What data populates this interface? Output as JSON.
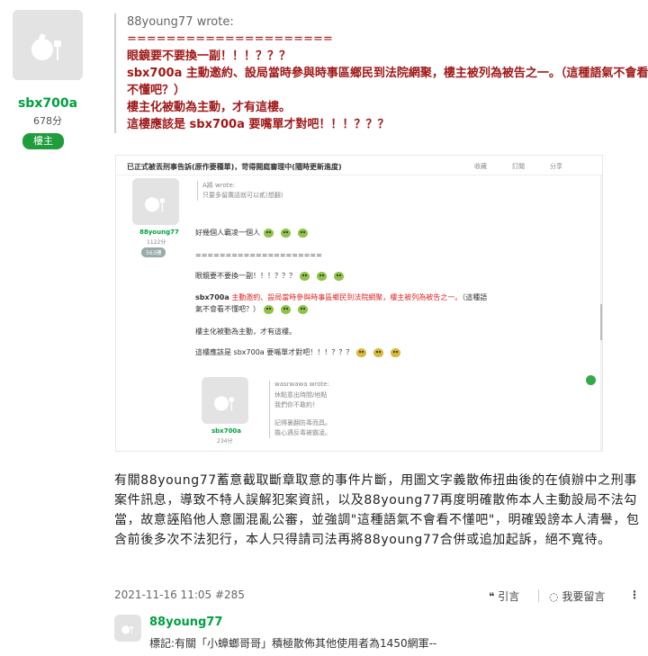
{
  "poster": {
    "username": "sbx700a",
    "points": "678分",
    "badge": "樓主"
  },
  "quote": {
    "author": "88young77 wrote:",
    "divider": "=====================",
    "lines": [
      "眼鏡要不要換一副！！！？？？",
      "sbx700a 主動邀約、設局當時參與時事區鄉民到法院網聚，樓主被列為被告之一。（這種語氣不會看",
      "不懂吧？）",
      "樓主化被動為主動，才有這樓。",
      "這樓應該是 sbx700a 要嘴單才對吧！！！？？？"
    ]
  },
  "screenshot": {
    "title": "已正式被丟刑事告訴(原作要種單)，苛得開庭審理中(隨時更新進度)",
    "actions": [
      "收藏",
      "訂閱",
      "分享"
    ],
    "user": {
      "name": "88young77",
      "points": "1122分",
      "badge": "563樓"
    },
    "quote_author": "A將 wrote:",
    "quote_text": "只要多留廣話就可以貳(想翻)",
    "line1": "好幾個人霸凌一個人",
    "divider": "=====================",
    "line2": "眼鏡要不要換一副！！！？？？",
    "line3a": "sbx700a",
    "line3b": "主動邀約、設局當時參與時事區鄉民到法院網聚，樓主被列為被告之一。",
    "line3c": "（這種語",
    "line3d": "氣不會看不懂吧？）",
    "line4": "樓主化被動為主動，才有這樓。",
    "line5": "這樓應該是 sbx700a 要嘴單才對吧！！！？？？",
    "user2": {
      "name": "sbx700a",
      "points": "234分"
    },
    "quote2_author": "wasrwawa wrote:",
    "quote2_lines": [
      "休點意出時間/地點",
      "我們你不敢約！",
      "記得裏翻防毒而具。",
      "擔心遇反毒被霸凌。"
    ]
  },
  "body": "有關88young77蓄意截取斷章取意的事件片斷，用圖文字義散佈扭曲後的在偵辦中之刑事案件訊息，導致不特人誤解犯案資訊，以及88young77再度明確散佈本人主動設局不法勾當，故意誣陷他人意圖混亂公審，並強調\"這種語氣不會看不懂吧\"，明確毀謗本人清譽，包含前後多次不法犯行，本人只得請司法再將88young77合併或追加起訴，絕不寬待。",
  "meta": {
    "date": "2021-11-16 11:05",
    "floor": "#285",
    "quote_label": "引言",
    "reply_label": "我要留言"
  },
  "reply": {
    "username": "88young77",
    "text": "標記:有關「小蟑螂哥哥」積極散佈其他使用者為1450網軍--"
  },
  "colors": {
    "username": "#00a040",
    "badge": "#1f9c3c",
    "quote_text": "#a01818"
  }
}
